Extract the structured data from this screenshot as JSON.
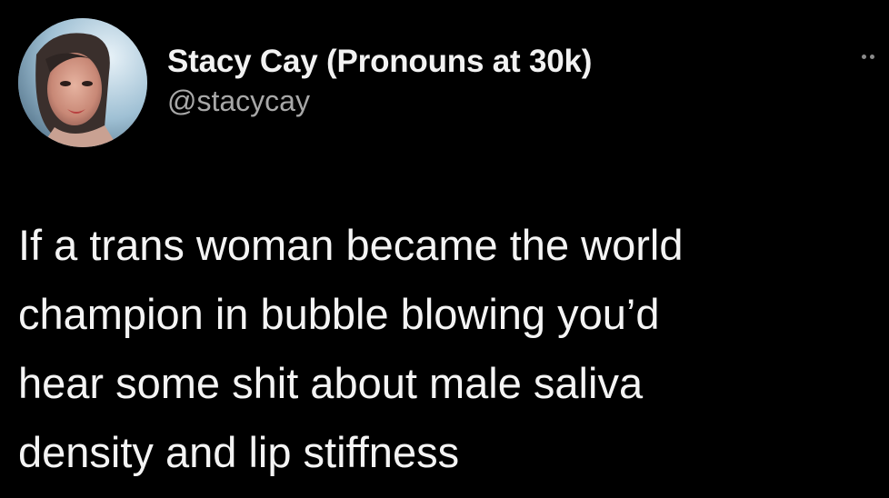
{
  "tweet": {
    "author": {
      "display_name": "Stacy Cay (Pronouns at 30k)",
      "handle": "@stacycay",
      "avatar_icon": "profile-photo"
    },
    "more_icon": "more-options-icon",
    "text_lines": [
      "If a trans woman became the world",
      "champion in bubble blowing you’d",
      "hear some shit about male saliva",
      "density and lip stiffness"
    ]
  },
  "colors": {
    "background": "#000000",
    "text": "#f4f4f4",
    "handle": "#a8a8a8"
  }
}
